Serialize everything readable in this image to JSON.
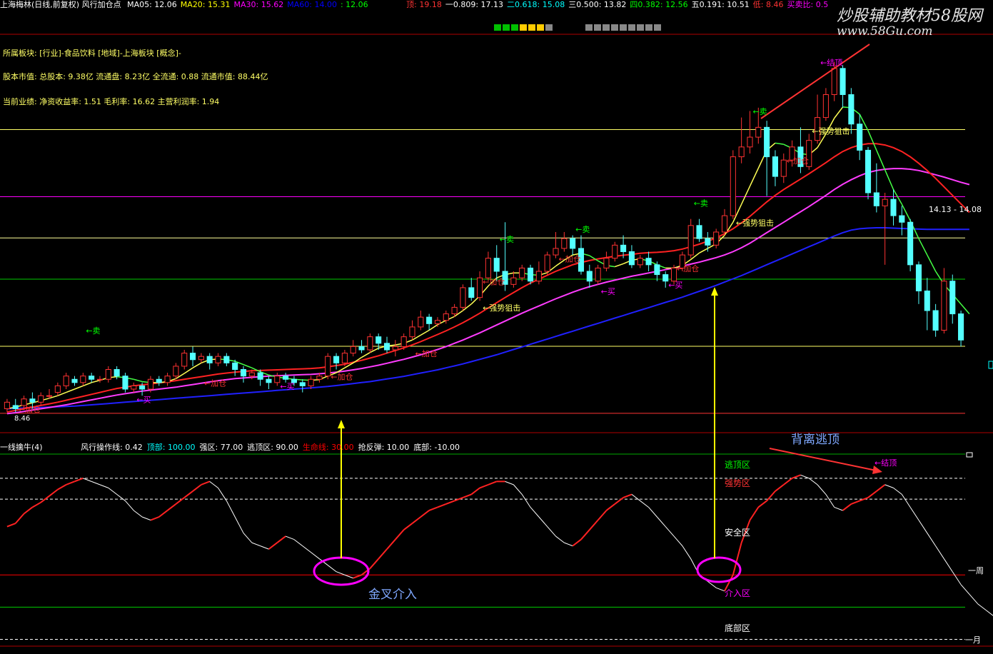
{
  "header": {
    "title": "上海梅林(日线,前复权) 风行加仓点",
    "ma": [
      {
        "label": "MA05: 12.06",
        "color": "#ffffff"
      },
      {
        "label": "MA20: 15.31",
        "color": "#ffff00"
      },
      {
        "label": "MA30: 15.62",
        "color": "#ff00ff"
      },
      {
        "label": "MA60: 14.00",
        "color": "#0000ff"
      },
      {
        "label": ": 12.06",
        "color": "#00ff00"
      }
    ],
    "levels": [
      {
        "label": "顶: 19.18",
        "color": "#ff3333"
      },
      {
        "label": "一0.809: 17.13",
        "color": "#ffffff"
      },
      {
        "label": "二0.618: 15.08",
        "color": "#00ffff"
      },
      {
        "label": "三0.500: 13.82",
        "color": "#ffffff"
      },
      {
        "label": "四0.382: 12.56",
        "color": "#00ff00"
      },
      {
        "label": "五0.191: 10.51",
        "color": "#ffffff"
      },
      {
        "label": "低: 8.46",
        "color": "#ff3333"
      },
      {
        "label": "买卖比: 0.5",
        "color": "#ff00ff"
      }
    ]
  },
  "info_lines": {
    "sector": "所属板块: [行业]-食品饮料 [地域]-上海板块 [概念]-",
    "capital": "股本市值: 总股本: 9.38亿 流通盘: 8.23亿 全流通: 0.88 流通市值: 88.44亿",
    "performance": "当前业绩: 净资收益率: 1.51 毛利率: 16.62 主营利润率: 1.94"
  },
  "watermark": {
    "line1": "炒股辅助教材58股网",
    "line2": "www.58Gu.com"
  },
  "colors": {
    "up": "#ff3232",
    "down": "#54ffff",
    "ma5": "#ffffff",
    "ma20": "#ff2222",
    "ma30": "#ff3cff",
    "ma60": "#2020ff",
    "grid_red": "#b00000"
  },
  "price_axis": {
    "ymin": 8.0,
    "ymax": 20.0
  },
  "hlines": [
    {
      "value": 17.13,
      "color": "#ffff66"
    },
    {
      "value": 15.08,
      "color": "#ff00ff"
    },
    {
      "value": 13.82,
      "color": "#ffff99"
    },
    {
      "value": 12.56,
      "color": "#00cc00"
    },
    {
      "value": 10.51,
      "color": "#ffff66"
    },
    {
      "value": 8.46,
      "color": "#ff3333"
    }
  ],
  "price_labels": {
    "right_price": "14.13 - 14.08",
    "low_price": "8.46"
  },
  "signals": [
    {
      "text": "←卖",
      "color": "#00ff00",
      "i": 9,
      "v": 10.9
    },
    {
      "text": "←加仓",
      "color": "#ff3333",
      "i": 1,
      "v": 8.5
    },
    {
      "text": "←买",
      "color": "#ff00ff",
      "i": 15,
      "v": 8.8
    },
    {
      "text": "←加仓",
      "color": "#ff3333",
      "i": 23,
      "v": 9.3
    },
    {
      "text": "←买",
      "color": "#ff00ff",
      "i": 32,
      "v": 9.2
    },
    {
      "text": "←加仓",
      "color": "#ff3333",
      "i": 38,
      "v": 9.5
    },
    {
      "text": "←加仓",
      "color": "#ff3333",
      "i": 48,
      "v": 10.2
    },
    {
      "text": "←强势狙击",
      "color": "#ffff66",
      "i": 56,
      "v": 11.6
    },
    {
      "text": "←加仓",
      "color": "#ff3333",
      "i": 56,
      "v": 12.4
    },
    {
      "text": "←卖",
      "color": "#00ff00",
      "i": 58,
      "v": 13.7
    },
    {
      "text": "←加仓",
      "color": "#ff3333",
      "i": 65,
      "v": 13.1
    },
    {
      "text": "←卖",
      "color": "#00ff00",
      "i": 67,
      "v": 14.0
    },
    {
      "text": "←买",
      "color": "#ff00ff",
      "i": 70,
      "v": 12.1
    },
    {
      "text": "←加仓",
      "color": "#ff3333",
      "i": 79,
      "v": 12.8
    },
    {
      "text": "←买",
      "color": "#ff00ff",
      "i": 78,
      "v": 12.3
    },
    {
      "text": "←卖",
      "color": "#00ff00",
      "i": 81,
      "v": 14.8
    },
    {
      "text": "←强势狙击",
      "color": "#ffff66",
      "i": 86,
      "v": 14.2
    },
    {
      "text": "←卖",
      "color": "#00ff00",
      "i": 88,
      "v": 17.6
    },
    {
      "text": "←强势狙击",
      "color": "#ffff66",
      "i": 95,
      "v": 17.0
    },
    {
      "text": "←加仓",
      "color": "#ff3333",
      "i": 92,
      "v": 16.1
    },
    {
      "text": "←结顶",
      "color": "#ff00ff",
      "i": 96,
      "v": 19.1
    }
  ],
  "chart_data": {
    "type": "candlestick",
    "candles": [
      [
        8.6,
        8.8,
        8.5,
        8.9
      ],
      [
        8.7,
        8.6,
        8.5,
        8.9
      ],
      [
        8.7,
        8.9,
        8.6,
        9.0
      ],
      [
        8.9,
        8.8,
        8.6,
        9.1
      ],
      [
        8.8,
        9.0,
        8.7,
        9.1
      ],
      [
        9.0,
        9.0,
        8.9,
        9.2
      ],
      [
        9.1,
        9.3,
        9.0,
        9.4
      ],
      [
        9.3,
        9.6,
        9.2,
        9.7
      ],
      [
        9.5,
        9.4,
        9.3,
        9.6
      ],
      [
        9.4,
        9.6,
        9.3,
        9.7
      ],
      [
        9.6,
        9.5,
        9.4,
        9.7
      ],
      [
        9.5,
        9.5,
        9.4,
        9.6
      ],
      [
        9.5,
        9.8,
        9.4,
        9.9
      ],
      [
        9.8,
        9.6,
        9.5,
        9.9
      ],
      [
        9.6,
        9.2,
        9.1,
        9.7
      ],
      [
        9.2,
        9.3,
        9.1,
        9.4
      ],
      [
        9.3,
        9.2,
        9.0,
        9.4
      ],
      [
        9.2,
        9.5,
        9.1,
        9.6
      ],
      [
        9.5,
        9.4,
        9.3,
        9.6
      ],
      [
        9.4,
        9.6,
        9.3,
        9.7
      ],
      [
        9.6,
        9.9,
        9.5,
        10.0
      ],
      [
        9.9,
        10.3,
        9.8,
        10.4
      ],
      [
        10.3,
        10.1,
        9.9,
        10.5
      ],
      [
        10.1,
        10.2,
        10.0,
        10.3
      ],
      [
        10.2,
        10.0,
        9.8,
        10.3
      ],
      [
        10.0,
        10.2,
        9.9,
        10.3
      ],
      [
        10.2,
        10.0,
        9.9,
        10.3
      ],
      [
        10.0,
        9.8,
        9.6,
        10.1
      ],
      [
        9.8,
        9.6,
        9.4,
        9.9
      ],
      [
        9.6,
        9.7,
        9.5,
        9.8
      ],
      [
        9.7,
        9.5,
        9.3,
        9.8
      ],
      [
        9.5,
        9.4,
        9.2,
        9.6
      ],
      [
        9.4,
        9.6,
        9.3,
        9.7
      ],
      [
        9.6,
        9.5,
        9.4,
        9.7
      ],
      [
        9.5,
        9.4,
        9.3,
        9.6
      ],
      [
        9.4,
        9.3,
        9.1,
        9.5
      ],
      [
        9.3,
        9.5,
        9.2,
        9.6
      ],
      [
        9.5,
        9.6,
        9.4,
        9.7
      ],
      [
        9.6,
        10.2,
        9.5,
        10.3
      ],
      [
        10.2,
        10.0,
        9.8,
        10.3
      ],
      [
        10.0,
        10.3,
        9.9,
        10.4
      ],
      [
        10.3,
        10.5,
        10.2,
        10.7
      ],
      [
        10.5,
        10.4,
        10.3,
        10.7
      ],
      [
        10.4,
        10.8,
        10.3,
        10.9
      ],
      [
        10.8,
        10.6,
        10.4,
        10.9
      ],
      [
        10.6,
        10.4,
        10.3,
        10.8
      ],
      [
        10.4,
        10.5,
        10.2,
        10.7
      ],
      [
        10.5,
        10.8,
        10.4,
        10.9
      ],
      [
        10.8,
        11.1,
        10.7,
        11.3
      ],
      [
        11.1,
        11.4,
        11.0,
        11.6
      ],
      [
        11.4,
        11.2,
        11.0,
        11.5
      ],
      [
        11.2,
        11.3,
        11.1,
        11.4
      ],
      [
        11.3,
        11.5,
        11.2,
        11.6
      ],
      [
        11.5,
        11.7,
        11.4,
        11.8
      ],
      [
        11.7,
        12.3,
        11.6,
        12.4
      ],
      [
        12.3,
        12.0,
        11.9,
        12.6
      ],
      [
        12.0,
        12.6,
        11.9,
        12.8
      ],
      [
        12.6,
        13.2,
        12.5,
        13.4
      ],
      [
        13.2,
        12.8,
        12.5,
        13.6
      ],
      [
        12.8,
        12.4,
        12.2,
        14.3
      ],
      [
        12.4,
        12.6,
        12.3,
        12.8
      ],
      [
        12.6,
        12.9,
        12.5,
        13.0
      ],
      [
        12.9,
        12.5,
        12.4,
        13.0
      ],
      [
        12.5,
        12.8,
        12.4,
        13.1
      ],
      [
        12.8,
        13.3,
        12.7,
        13.4
      ],
      [
        13.3,
        13.5,
        13.2,
        14.0
      ],
      [
        13.5,
        13.8,
        13.4,
        14.0
      ],
      [
        13.8,
        13.5,
        13.3,
        13.9
      ],
      [
        13.5,
        12.8,
        12.7,
        13.9
      ],
      [
        12.8,
        12.5,
        12.3,
        13.0
      ],
      [
        12.5,
        12.9,
        12.4,
        13.0
      ],
      [
        12.9,
        13.2,
        12.8,
        13.4
      ],
      [
        13.2,
        13.6,
        13.1,
        13.7
      ],
      [
        13.6,
        13.4,
        13.2,
        13.9
      ],
      [
        13.4,
        13.0,
        12.9,
        13.6
      ],
      [
        13.0,
        13.2,
        12.9,
        13.3
      ],
      [
        13.2,
        13.0,
        12.8,
        13.4
      ],
      [
        13.0,
        12.7,
        12.5,
        13.1
      ],
      [
        12.7,
        12.5,
        12.3,
        12.8
      ],
      [
        12.5,
        12.9,
        12.4,
        13.0
      ],
      [
        12.9,
        13.3,
        12.8,
        13.4
      ],
      [
        13.3,
        14.2,
        13.2,
        14.4
      ],
      [
        14.2,
        13.8,
        13.7,
        14.4
      ],
      [
        13.8,
        13.6,
        13.4,
        14.0
      ],
      [
        13.6,
        14.0,
        13.5,
        14.1
      ],
      [
        14.0,
        14.5,
        13.9,
        14.7
      ],
      [
        14.5,
        16.3,
        14.4,
        16.5
      ],
      [
        16.3,
        16.6,
        16.1,
        17.5
      ],
      [
        16.6,
        16.9,
        16.4,
        17.7
      ],
      [
        16.9,
        17.2,
        16.7,
        17.8
      ],
      [
        17.2,
        16.3,
        15.1,
        17.4
      ],
      [
        16.3,
        15.7,
        15.4,
        16.5
      ],
      [
        15.7,
        16.2,
        15.5,
        16.4
      ],
      [
        16.2,
        16.6,
        16.0,
        16.8
      ],
      [
        16.6,
        16.0,
        15.8,
        17.2
      ],
      [
        16.0,
        16.8,
        15.9,
        17.0
      ],
      [
        16.8,
        17.5,
        16.7,
        18.2
      ],
      [
        17.5,
        18.2,
        17.4,
        18.4
      ],
      [
        18.2,
        19.0,
        18.0,
        19.2
      ],
      [
        19.0,
        18.2,
        17.8,
        19.1
      ],
      [
        18.2,
        17.3,
        17.0,
        18.4
      ],
      [
        17.3,
        16.5,
        16.2,
        17.6
      ],
      [
        16.5,
        15.2,
        15.0,
        16.6
      ],
      [
        15.2,
        14.8,
        14.6,
        16.1
      ],
      [
        14.8,
        15.0,
        13.0,
        15.2
      ],
      [
        15.0,
        14.5,
        14.2,
        15.3
      ],
      [
        14.5,
        14.3,
        13.9,
        14.8
      ],
      [
        14.3,
        13.0,
        12.8,
        14.4
      ],
      [
        13.0,
        12.2,
        11.8,
        13.1
      ],
      [
        12.2,
        11.6,
        11.0,
        12.6
      ],
      [
        11.6,
        11.0,
        10.8,
        11.8
      ],
      [
        11.0,
        12.5,
        10.9,
        12.9
      ],
      [
        12.5,
        11.5,
        11.2,
        12.7
      ],
      [
        11.5,
        10.7,
        10.5,
        11.6
      ]
    ],
    "ma5": [
      8.6,
      8.65,
      8.72,
      8.78,
      8.85,
      8.92,
      9.0,
      9.1,
      9.2,
      9.3,
      9.4,
      9.47,
      9.55,
      9.58,
      9.55,
      9.5,
      9.43,
      9.4,
      9.4,
      9.43,
      9.52,
      9.68,
      9.85,
      10.0,
      10.1,
      10.12,
      10.1,
      10.05,
      9.95,
      9.85,
      9.73,
      9.63,
      9.57,
      9.53,
      9.5,
      9.48,
      9.47,
      9.49,
      9.6,
      9.7,
      9.85,
      10.0,
      10.17,
      10.32,
      10.45,
      10.52,
      10.55,
      10.6,
      10.7,
      10.85,
      11.0,
      11.17,
      11.3,
      11.42,
      11.6,
      11.8,
      12.05,
      12.35,
      12.6,
      12.7,
      12.75,
      12.75,
      12.7,
      12.68,
      12.76,
      12.96,
      13.14,
      13.3,
      13.35,
      13.28,
      13.12,
      12.98,
      12.94,
      13.03,
      13.14,
      13.18,
      13.12,
      13.0,
      12.9,
      12.9,
      12.98,
      13.16,
      13.36,
      13.5,
      13.64,
      13.9,
      14.3,
      14.85,
      15.4,
      15.95,
      16.5,
      16.72,
      16.68,
      16.56,
      16.4,
      16.36,
      16.58,
      17.0,
      17.48,
      17.82,
      17.8,
      17.6,
      17.1,
      16.5,
      15.9,
      15.3,
      14.85,
      14.35,
      13.8,
      13.3,
      12.8,
      12.4,
      12.1,
      11.8,
      11.5
    ],
    "ma20": [
      8.5,
      8.55,
      8.6,
      8.65,
      8.7,
      8.75,
      8.8,
      8.86,
      8.92,
      8.98,
      9.04,
      9.1,
      9.16,
      9.22,
      9.26,
      9.3,
      9.33,
      9.36,
      9.39,
      9.42,
      9.46,
      9.5,
      9.54,
      9.58,
      9.62,
      9.66,
      9.69,
      9.72,
      9.74,
      9.76,
      9.77,
      9.78,
      9.79,
      9.8,
      9.81,
      9.82,
      9.83,
      9.85,
      9.88,
      9.92,
      9.96,
      10.02,
      10.08,
      10.15,
      10.22,
      10.3,
      10.38,
      10.46,
      10.55,
      10.65,
      10.76,
      10.87,
      10.98,
      11.1,
      11.23,
      11.37,
      11.52,
      11.68,
      11.84,
      12.0,
      12.15,
      12.3,
      12.44,
      12.56,
      12.68,
      12.8,
      12.9,
      13.0,
      13.07,
      13.13,
      13.18,
      13.22,
      13.26,
      13.29,
      13.32,
      13.35,
      13.37,
      13.38,
      13.4,
      13.43,
      13.48,
      13.55,
      13.63,
      13.72,
      13.82,
      13.95,
      14.1,
      14.28,
      14.48,
      14.7,
      14.92,
      15.12,
      15.3,
      15.46,
      15.62,
      15.78,
      15.95,
      16.12,
      16.3,
      16.46,
      16.58,
      16.66,
      16.7,
      16.7,
      16.66,
      16.58,
      16.46,
      16.3,
      16.1,
      15.88,
      15.64,
      15.38,
      15.12,
      14.86,
      14.6
    ],
    "ma30": [
      8.45,
      8.48,
      8.52,
      8.56,
      8.6,
      8.64,
      8.68,
      8.72,
      8.77,
      8.82,
      8.87,
      8.92,
      8.97,
      9.02,
      9.06,
      9.1,
      9.14,
      9.17,
      9.2,
      9.23,
      9.26,
      9.3,
      9.34,
      9.38,
      9.42,
      9.46,
      9.49,
      9.52,
      9.54,
      9.56,
      9.58,
      9.6,
      9.61,
      9.62,
      9.63,
      9.64,
      9.65,
      9.67,
      9.69,
      9.72,
      9.75,
      9.79,
      9.83,
      9.88,
      9.93,
      9.99,
      10.05,
      10.11,
      10.18,
      10.25,
      10.33,
      10.41,
      10.5,
      10.6,
      10.7,
      10.81,
      10.92,
      11.04,
      11.16,
      11.28,
      11.4,
      11.52,
      11.63,
      11.74,
      11.85,
      11.96,
      12.06,
      12.16,
      12.25,
      12.33,
      12.4,
      12.47,
      12.53,
      12.59,
      12.65,
      12.7,
      12.75,
      12.8,
      12.85,
      12.9,
      12.96,
      13.02,
      13.08,
      13.15,
      13.22,
      13.3,
      13.4,
      13.52,
      13.66,
      13.82,
      13.98,
      14.14,
      14.3,
      14.46,
      14.62,
      14.78,
      14.95,
      15.12,
      15.3,
      15.46,
      15.6,
      15.72,
      15.82,
      15.88,
      15.92,
      15.94,
      15.94,
      15.92,
      15.88,
      15.82,
      15.75,
      15.68,
      15.6,
      15.52,
      15.45
    ],
    "ma60": [
      8.6,
      8.61,
      8.62,
      8.63,
      8.64,
      8.65,
      8.66,
      8.67,
      8.68,
      8.7,
      8.72,
      8.74,
      8.76,
      8.78,
      8.8,
      8.82,
      8.84,
      8.86,
      8.88,
      8.9,
      8.92,
      8.94,
      8.96,
      8.98,
      9.0,
      9.02,
      9.04,
      9.06,
      9.08,
      9.1,
      9.12,
      9.14,
      9.16,
      9.18,
      9.2,
      9.22,
      9.24,
      9.26,
      9.28,
      9.31,
      9.34,
      9.37,
      9.4,
      9.43,
      9.47,
      9.51,
      9.55,
      9.59,
      9.64,
      9.69,
      9.74,
      9.79,
      9.85,
      9.91,
      9.97,
      10.04,
      10.11,
      10.18,
      10.25,
      10.33,
      10.41,
      10.49,
      10.57,
      10.65,
      10.73,
      10.81,
      10.89,
      10.97,
      11.05,
      11.13,
      11.21,
      11.29,
      11.37,
      11.45,
      11.53,
      11.61,
      11.69,
      11.77,
      11.85,
      11.93,
      12.01,
      12.1,
      12.19,
      12.28,
      12.37,
      12.47,
      12.57,
      12.67,
      12.78,
      12.89,
      13.0,
      13.11,
      13.22,
      13.33,
      13.44,
      13.55,
      13.66,
      13.77,
      13.88,
      13.98,
      14.06,
      14.1,
      14.12,
      14.13,
      14.13,
      14.12,
      14.11,
      14.1,
      14.09,
      14.08,
      14.08,
      14.08,
      14.08,
      14.08,
      14.08
    ]
  },
  "indicator": {
    "name": "一线擒牛(4)",
    "params": [
      {
        "label": "风行操作线: 0.42",
        "color": "#ffffff"
      },
      {
        "label": "顶部: 100.00",
        "color": "#00ffff"
      },
      {
        "label": "强区: 77.00",
        "color": "#ffffff"
      },
      {
        "label": "逃顶区: 90.00",
        "color": "#ffffff"
      },
      {
        "label": "生命线: 30.00",
        "color": "#ff0000"
      },
      {
        "label": "抢反弹: 10.00",
        "color": "#ffffff"
      },
      {
        "label": "底部: -10.00",
        "color": "#ffffff"
      }
    ],
    "ymin": -12,
    "ymax": 105,
    "values": [
      60,
      62,
      68,
      72,
      75,
      79,
      83,
      86,
      88,
      90,
      88,
      86,
      84,
      80,
      76,
      70,
      66,
      64,
      66,
      70,
      74,
      78,
      82,
      86,
      88,
      84,
      76,
      66,
      56,
      50,
      48,
      46,
      50,
      54,
      52,
      48,
      44,
      40,
      36,
      32,
      30,
      28,
      30,
      34,
      40,
      46,
      52,
      58,
      62,
      66,
      70,
      72,
      74,
      76,
      78,
      80,
      84,
      86,
      88,
      88,
      86,
      80,
      72,
      66,
      60,
      54,
      50,
      48,
      52,
      58,
      64,
      70,
      74,
      78,
      80,
      76,
      72,
      66,
      60,
      54,
      48,
      40,
      30,
      26,
      22,
      20,
      30,
      50,
      64,
      72,
      76,
      82,
      86,
      90,
      92,
      90,
      86,
      80,
      72,
      70,
      74,
      76,
      78,
      82,
      86,
      84,
      80,
      72,
      64,
      56,
      48,
      40,
      32,
      24,
      18,
      12,
      8,
      4,
      0,
      -4,
      -6
    ]
  },
  "ind_labels": {
    "escape": "逃顶区",
    "strong": "强势区",
    "safe": "安全区",
    "entry": "介入区",
    "bottom": "底部区",
    "week": "一周",
    "month": "一月",
    "divergence": "背离逃顶",
    "golden": "金叉介入",
    "top_signal": "←结顶"
  }
}
